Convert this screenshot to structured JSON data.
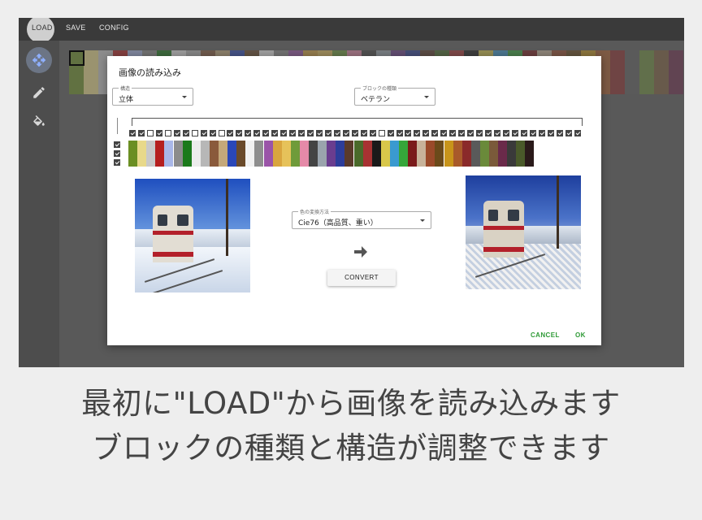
{
  "menu": {
    "load_label": "LOAD",
    "save_label": "SAVE",
    "config_label": "CONFIG"
  },
  "tools": [
    {
      "icon": "move-icon"
    },
    {
      "icon": "pencil-icon"
    },
    {
      "icon": "fill-bucket-icon"
    }
  ],
  "dialog": {
    "title": "画像の読み込み",
    "structure": {
      "label": "構造",
      "value": "立体"
    },
    "block_type": {
      "label": "ブロックの種類",
      "value": "ベテラン"
    },
    "color_method": {
      "label": "色の変換方法",
      "value": "Cie76（高品質、重い）"
    },
    "convert_label": "CONVERT",
    "cancel_label": "CANCEL",
    "ok_label": "OK"
  },
  "palette": {
    "colors": [
      "#6b8f23",
      "#e8d98a",
      "#c9c9c9",
      "#b51f1f",
      "#a9b7e8",
      "#8c8c8c",
      "#1b7a1b",
      "#ececec",
      "#b7b7b7",
      "#8a5a3b",
      "#c4a87a",
      "#2a47b8",
      "#6a4a2a",
      "#f1f1f1",
      "#8e8e8e",
      "#9a54a8",
      "#d9a53e",
      "#e6c25a",
      "#6f9b3a",
      "#e58aa8",
      "#444444",
      "#9aa4ad",
      "#6a3d8f",
      "#2d3d9a",
      "#5a3a2a",
      "#4a6a2a",
      "#a83232",
      "#1a1a1a",
      "#d8c74a",
      "#3a9ad0",
      "#36a63a",
      "#7a1a1a",
      "#c8b39a",
      "#9a4a2a",
      "#6b4a1a",
      "#c8941a",
      "#a85a2a",
      "#8a2a2a",
      "#5a5a5a",
      "#6a8a3a",
      "#7a5a3a",
      "#6a2a4a",
      "#3a3a3a",
      "#4a5a2a",
      "#2a1a1a"
    ],
    "enabled": [
      true,
      true,
      false,
      true,
      false,
      true,
      true,
      false,
      true,
      true,
      false,
      true,
      true,
      true,
      true,
      true,
      true,
      true,
      true,
      true,
      true,
      true,
      true,
      true,
      true,
      true,
      true,
      true,
      false,
      true,
      true,
      true,
      true,
      true,
      true,
      true,
      true,
      true,
      true,
      true,
      true,
      true,
      true,
      true,
      true,
      true,
      true,
      true,
      true,
      true,
      true
    ],
    "row_toggles": [
      true,
      true,
      true
    ]
  },
  "caption": {
    "line1": "最初に\"LOAD\"から画像を読み込みます",
    "line2": "ブロックの種類と構造が調整できます"
  }
}
